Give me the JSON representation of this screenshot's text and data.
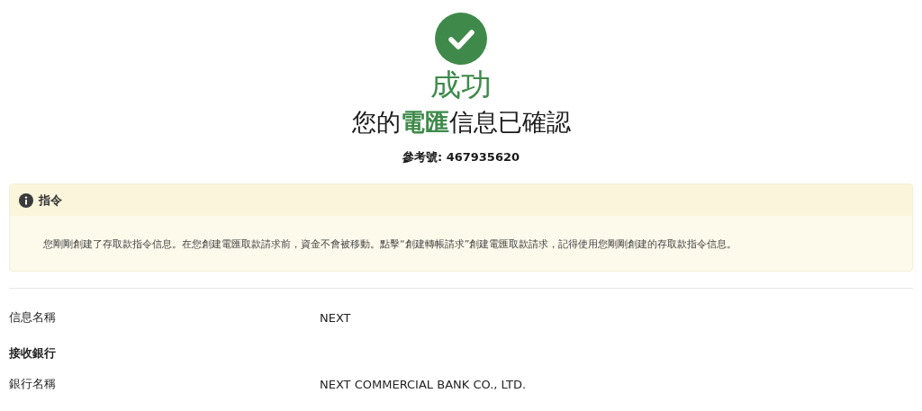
{
  "status": {
    "title": "成功",
    "heading": {
      "before": "您的",
      "highlight": "電匯",
      "after": "信息已確認"
    },
    "reference": "參考號: 467935620"
  },
  "notice": {
    "title": "指令",
    "body": "您剛剛創建了存取款指令信息。在您創建電匯取款請求前，資金不會被移動。點擊“創建轉帳請求”創建電匯取款請求，記得使用您剛剛創建的存取款指令信息。"
  },
  "details": [
    {
      "kind": "field",
      "label": "信息名稱",
      "value": "NEXT"
    },
    {
      "kind": "section",
      "label": "接收銀行"
    },
    {
      "kind": "field",
      "label": "銀行名稱",
      "value": "NEXT COMMERCIAL BANK CO., LTD."
    }
  ]
}
